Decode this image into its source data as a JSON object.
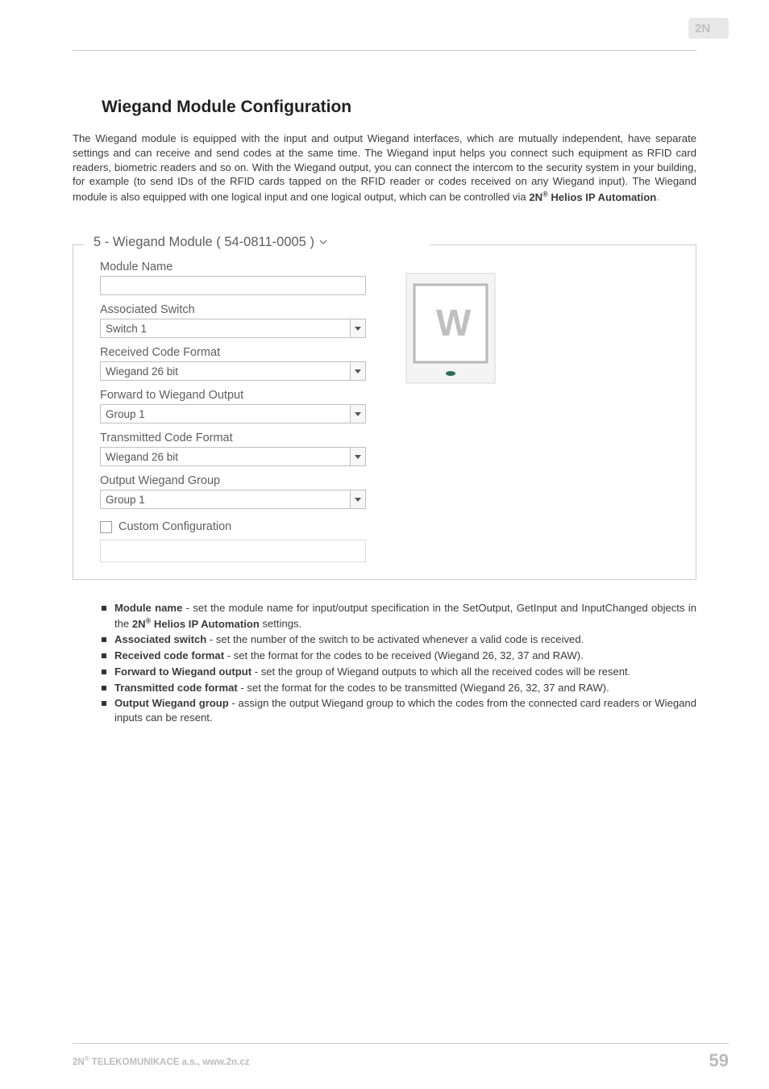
{
  "header": {
    "logo_name": "2N-logo"
  },
  "heading": "Wiegand Module Configuration",
  "intro_html": "The Wiegand module is equipped with the input and output Wiegand interfaces, which are mutually independent, have separate settings and can receive and send codes at the same time. The Wiegand input helps you connect such equipment as RFID card readers, biometric readers and so on. With the Wiegand output, you can connect the intercom to the security system in your building, for example (to send IDs of the RFID cards tapped on the RFID reader or codes received on any Wiegand input). The Wiegand module is also equipped with one logical input and one logical output, which can be controlled via ",
  "intro_brand_prefix": "2N",
  "intro_brand_rest": " Helios IP Automation",
  "panel": {
    "legend": "5 - Wiegand Module ( 54-0811-0005 )",
    "fields": {
      "module_name_label": "Module Name",
      "module_name_value": "",
      "associated_switch_label": "Associated Switch",
      "associated_switch_value": "Switch 1",
      "received_format_label": "Received Code Format",
      "received_format_value": "Wiegand 26 bit",
      "forward_label": "Forward to Wiegand Output",
      "forward_value": "Group 1",
      "transmitted_format_label": "Transmitted Code Format",
      "transmitted_format_value": "Wiegand 26 bit",
      "output_group_label": "Output Wiegand Group",
      "output_group_value": "Group 1",
      "custom_config_label": "Custom Configuration"
    }
  },
  "bullets": [
    {
      "term": "Module name",
      "rest": " - set the module name for input/output specification in the SetOutput, GetInput and InputChanged objects in the ",
      "brand_prefix": "2N",
      "brand_rest": " Helios IP Automation",
      "after_brand": " settings."
    },
    {
      "term": "Associated switch",
      "rest": " - set the number of the switch to be activated whenever a valid code is received",
      "blue_trail": "."
    },
    {
      "term": "Received code format",
      "rest": " - set the format for the codes to be received (Wiegand 26, 32, 37 and RAW)."
    },
    {
      "term": "Forward to Wiegand output",
      "rest": " - set the group of Wiegand outputs to which all the received codes will be resent",
      "blue_trail": "."
    },
    {
      "term": "Transmitted code format",
      "rest": " - set the format for the codes to be transmitted (Wiegand 26, 32, 37 and RAW)."
    },
    {
      "term": "Output Wiegand group",
      "rest": " - assign the output Wiegand group to which the codes from the connected card readers or Wiegand inputs can be resent."
    }
  ],
  "footer": {
    "company_prefix": "2N",
    "company_rest": " TELEKOMUNIKACE a.s., www.2n.cz",
    "page_number": "59"
  }
}
